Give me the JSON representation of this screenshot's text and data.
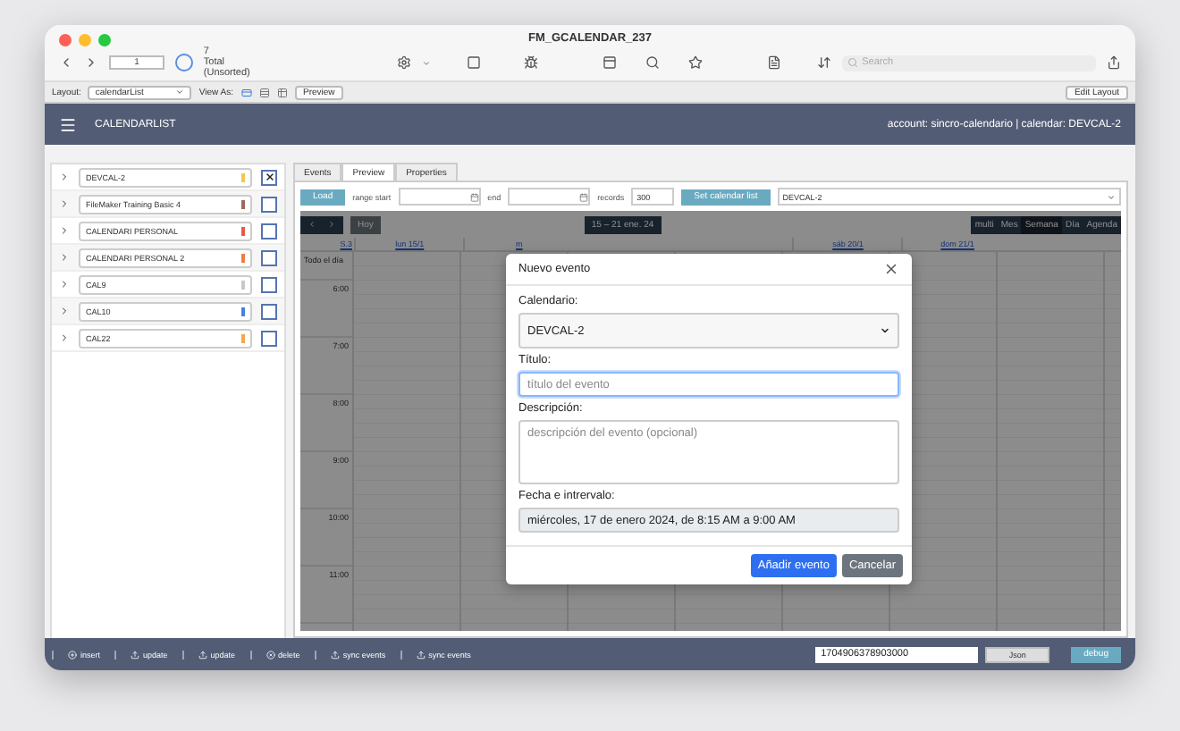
{
  "window": {
    "title": "FM_GCALENDAR_237"
  },
  "toolbar": {
    "record": "1",
    "found_count": "7",
    "sort_status": "Total (Unsorted)",
    "search": {
      "placeholder": "Search"
    }
  },
  "layout_bar": {
    "layout_label": "Layout:",
    "layout": "calendarList",
    "view_as_label": "View As:",
    "view_modes": [
      {
        "selected": true
      },
      {
        "selected": false
      },
      {
        "selected": false
      }
    ],
    "preview": "Preview",
    "edit_layout": "Edit Layout"
  },
  "header": {
    "title": "CALENDARLIST",
    "account": "account: sincro-calendario | calendar: DEVCAL-2"
  },
  "calendars": [
    {
      "name": "DEVCAL-2",
      "color": "#f2c94c",
      "checked": true
    },
    {
      "name": "FileMaker Training Basic 4",
      "color": "#a0695a",
      "checked": false
    },
    {
      "name": "CALENDARI PERSONAL",
      "color": "#e8574a",
      "checked": false
    },
    {
      "name": "CALENDARI PERSONAL 2",
      "color": "#ef7b45",
      "checked": false
    },
    {
      "name": "CAL9",
      "color": "#c8c8c8",
      "checked": false
    },
    {
      "name": "CAL10",
      "color": "#4a7fe0",
      "checked": false
    },
    {
      "name": "CAL22",
      "color": "#f2a84c",
      "checked": false
    }
  ],
  "tabs": [
    {
      "label": "Events",
      "selected": false
    },
    {
      "label": "Preview",
      "selected": true
    },
    {
      "label": "Properties",
      "selected": false
    }
  ],
  "controls": {
    "load": "Load",
    "range_start_label": "range start",
    "end_label": "end",
    "records_label": "records",
    "records": "300",
    "set_list": "Set calendar list",
    "calendar": "DEVCAL-2"
  },
  "calendar": {
    "today": "Hoy",
    "title": "15 – 21 ene. 24",
    "week": "S.3",
    "all_day": "Todo el día",
    "views": [
      {
        "label": "multi",
        "selected": false
      },
      {
        "label": "Mes",
        "selected": false
      },
      {
        "label": "Semana",
        "selected": true
      },
      {
        "label": "Día",
        "selected": false
      },
      {
        "label": "Agenda",
        "selected": false
      }
    ],
    "days_left": [
      "lun 15/1",
      "m"
    ],
    "days_right": [
      "sáb 20/1",
      "dom 21/1"
    ],
    "hours": [
      "6:00",
      "7:00",
      "8:00",
      "9:00",
      "10:00",
      "11:00"
    ]
  },
  "dialog": {
    "title": "Nuevo evento",
    "calendar_label": "Calendario:",
    "calendar": "DEVCAL-2",
    "title_label": "Título:",
    "title_placeholder": "título del evento",
    "description_label": "Descripción:",
    "description_placeholder": "descripción del evento (opcional)",
    "date_label": "Fecha e intrervalo:",
    "date": "miércoles, 17 de enero 2024, de 8:15 AM a 9:00 AM",
    "add": "Añadir evento",
    "cancel": "Cancelar"
  },
  "footer": {
    "buttons": [
      {
        "label": "insert",
        "kind": "plus"
      },
      {
        "label": "update",
        "kind": "upload"
      },
      {
        "label": "update",
        "kind": "upload"
      },
      {
        "label": "delete",
        "kind": "delete"
      },
      {
        "label": "sync events",
        "kind": "upload"
      },
      {
        "label": "sync events",
        "kind": "upload"
      }
    ],
    "timestamp": "1704906378903000",
    "json": "Json",
    "debug": "debug"
  }
}
